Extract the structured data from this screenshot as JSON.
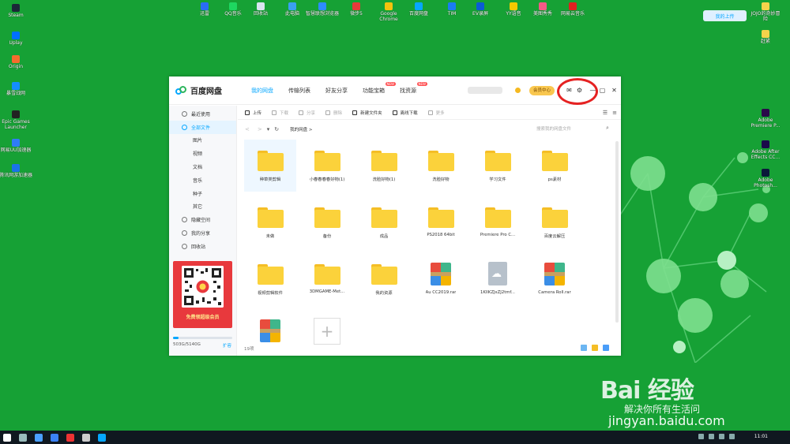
{
  "desktop": {
    "top_icons": [
      {
        "label": "迅雷",
        "color": "#2a6df4"
      },
      {
        "label": "QQ音乐",
        "color": "#1ed760"
      },
      {
        "label": "回收站",
        "color": "#d9e4ef"
      },
      {
        "label": "此电脑",
        "color": "#3aa0f0"
      },
      {
        "label": "智慧联想浏览器",
        "color": "#2d8cff"
      },
      {
        "label": "微步5",
        "color": "#e83a3a"
      },
      {
        "label": "Google Chrome",
        "color": "#f4c20d"
      },
      {
        "label": "百度网盘",
        "color": "#06a7ff"
      },
      {
        "label": "TIM",
        "color": "#1a7cf2"
      },
      {
        "label": "EV录屏",
        "color": "#0b5cd5"
      },
      {
        "label": "YY语音",
        "color": "#f3c900"
      },
      {
        "label": "美图秀秀",
        "color": "#f35b86"
      },
      {
        "label": "网易云音乐",
        "color": "#e02020"
      }
    ],
    "left_icons": [
      {
        "label": "Steam",
        "color": "#1b2838"
      },
      {
        "label": "Uplay",
        "color": "#0070ff"
      },
      {
        "label": "Origin",
        "color": "#f56c2d"
      },
      {
        "label": "暴雪战网",
        "color": "#148eff"
      },
      {
        "label": "Epic Games Launcher",
        "color": "#222222"
      },
      {
        "label": "网易UU加速器",
        "color": "#2f7cf6"
      },
      {
        "label": "腾讯网游加速器",
        "color": "#1a73e8"
      }
    ],
    "right_icons": [
      {
        "label": "JOJO的奇妙冒险",
        "color": "#f4d34b"
      },
      {
        "label": "赶紧",
        "color": "#f4d34b"
      },
      {
        "label": "Adobe Premiere P...",
        "color": "#2a0a4a"
      },
      {
        "label": "Adobe After Effects CC...",
        "color": "#1a0a4a"
      },
      {
        "label": "Adobe Photosh...",
        "color": "#0a1a3a"
      }
    ],
    "sync_button": "我的上传"
  },
  "window": {
    "app_title": "百度网盘",
    "nav_tabs": [
      {
        "label": "我的网盘",
        "active": true,
        "badge": ""
      },
      {
        "label": "传输列表",
        "active": false,
        "badge": ""
      },
      {
        "label": "好友分享",
        "active": false,
        "badge": ""
      },
      {
        "label": "功能宝箱",
        "active": false,
        "badge": "NEW"
      },
      {
        "label": "找资源",
        "active": false,
        "badge": "NEW"
      }
    ],
    "user_level": "5",
    "vip_button": "会员中心",
    "controls": {
      "mail": "✉",
      "settings": "⚙",
      "minimize": "—",
      "maximize": "▢",
      "close": "✕"
    },
    "sidebar": {
      "items": [
        {
          "label": "最近使用",
          "sub": false,
          "active": false
        },
        {
          "label": "全部文件",
          "sub": false,
          "active": true
        },
        {
          "label": "图片",
          "sub": true,
          "active": false
        },
        {
          "label": "视频",
          "sub": true,
          "active": false
        },
        {
          "label": "文档",
          "sub": true,
          "active": false
        },
        {
          "label": "音乐",
          "sub": true,
          "active": false
        },
        {
          "label": "种子",
          "sub": true,
          "active": false
        },
        {
          "label": "其它",
          "sub": true,
          "active": false
        },
        {
          "label": "隐藏空间",
          "sub": false,
          "active": false
        },
        {
          "label": "我的分享",
          "sub": false,
          "active": false
        },
        {
          "label": "回收站",
          "sub": false,
          "active": false
        }
      ],
      "promo_text": "免费领超级会员",
      "quota_text": "503G/5140G",
      "quota_fraction": 0.098,
      "expand_label": "扩容"
    },
    "toolbar": [
      {
        "label": "上传",
        "disabled": false
      },
      {
        "label": "下载",
        "disabled": true
      },
      {
        "label": "分享",
        "disabled": true
      },
      {
        "label": "删除",
        "disabled": true
      },
      {
        "label": "新建文件夹",
        "disabled": false
      },
      {
        "label": "离线下载",
        "disabled": false
      },
      {
        "label": "更多",
        "disabled": true
      }
    ],
    "breadcrumb": "我的网盘",
    "search_placeholder": "搜索我的网盘文件",
    "files": [
      {
        "name": "种草类剪辑",
        "type": "folder",
        "selected": true
      },
      {
        "name": "小春春春春好物(1)",
        "type": "folder",
        "selected": false
      },
      {
        "name": "洗脸好物(1)",
        "type": "folder",
        "selected": false
      },
      {
        "name": "洗脸好物",
        "type": "folder",
        "selected": false
      },
      {
        "name": "学习文件",
        "type": "folder",
        "selected": false
      },
      {
        "name": "ps素材",
        "type": "folder",
        "selected": false
      },
      {
        "name": "未做",
        "type": "folder",
        "selected": false
      },
      {
        "name": "备份",
        "type": "folder",
        "selected": false
      },
      {
        "name": "成品",
        "type": "folder",
        "selected": false
      },
      {
        "name": "PS2018 64bit",
        "type": "folder",
        "selected": false
      },
      {
        "name": "Premiere Pro C...",
        "type": "folder",
        "selected": false
      },
      {
        "name": "百度云解压",
        "type": "folder",
        "selected": false
      },
      {
        "name": "视频剪辑软件",
        "type": "folder",
        "selected": false
      },
      {
        "name": "3DMGAME-Met...",
        "type": "folder",
        "selected": false
      },
      {
        "name": "我的资源",
        "type": "folder",
        "selected": false
      },
      {
        "name": "Au CC2019.rar",
        "type": "rar",
        "selected": false
      },
      {
        "name": "1KIlKZJxZJ2tmf...",
        "type": "doc",
        "selected": false
      },
      {
        "name": "Camera Roll.rar",
        "type": "rar",
        "selected": false
      },
      {
        "name": "",
        "type": "rar",
        "selected": false
      },
      {
        "name": "",
        "type": "new",
        "selected": false
      }
    ],
    "item_count": "19项"
  },
  "watermark": {
    "logo": "Bai 经验",
    "slogan": "解决你所有生活问",
    "url": "jingyan.baidu.com"
  },
  "taskbar": {
    "clock": "11:01"
  }
}
